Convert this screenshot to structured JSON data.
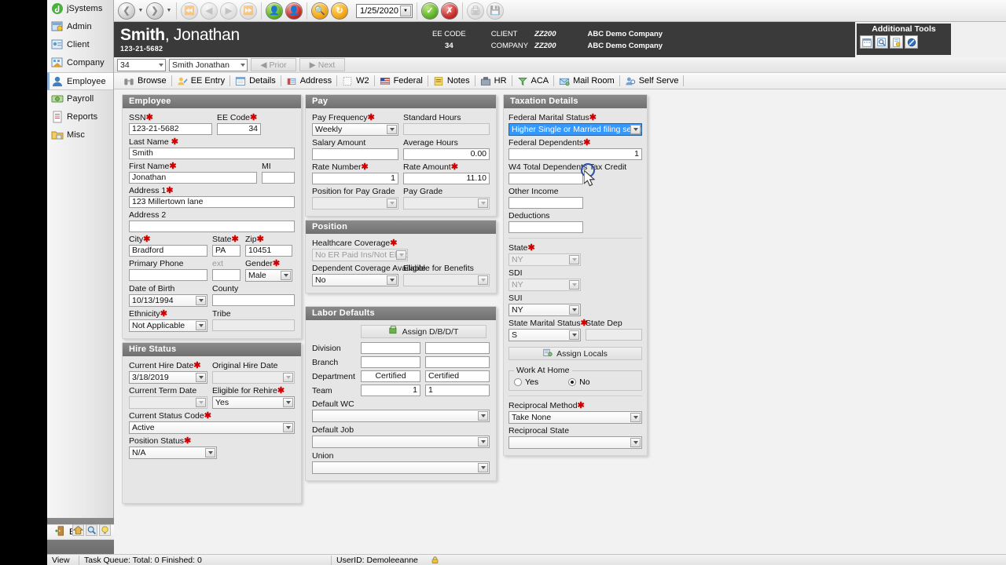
{
  "sidebar": {
    "items": [
      {
        "label": "jSystems",
        "icon": "app-logo-icon",
        "selected": false
      },
      {
        "label": "Admin",
        "icon": "admin-icon",
        "selected": false
      },
      {
        "label": "Client",
        "icon": "client-icon",
        "selected": false
      },
      {
        "label": "Company",
        "icon": "company-icon",
        "selected": false
      },
      {
        "label": "Employee",
        "icon": "employee-icon",
        "selected": true
      },
      {
        "label": "Payroll",
        "icon": "payroll-icon",
        "selected": false
      },
      {
        "label": "Reports",
        "icon": "reports-icon",
        "selected": false
      },
      {
        "label": "Misc",
        "icon": "misc-icon",
        "selected": false
      }
    ],
    "exit_label": "Exit",
    "quick_icons": [
      "home-icon",
      "search-icon",
      "help-icon"
    ]
  },
  "toolbar": {
    "date_value": "1/25/2020",
    "buttons": [
      {
        "name": "back-button",
        "icon": "arrow-back-icon"
      },
      {
        "name": "forward-button",
        "icon": "arrow-forward-icon"
      },
      {
        "name": "first-record-button",
        "icon": "first-record-icon"
      },
      {
        "name": "prev-record-button",
        "icon": "prev-record-icon"
      },
      {
        "name": "next-record-button",
        "icon": "next-record-icon"
      },
      {
        "name": "last-record-button",
        "icon": "last-record-icon"
      },
      {
        "name": "add-employee-button",
        "icon": "add-person-icon"
      },
      {
        "name": "delete-employee-button",
        "icon": "delete-person-icon"
      },
      {
        "name": "find-button",
        "icon": "magnifier-icon"
      },
      {
        "name": "refresh-button",
        "icon": "refresh-icon"
      },
      {
        "name": "save-button",
        "icon": "check-icon"
      },
      {
        "name": "cancel-button",
        "icon": "x-icon"
      },
      {
        "name": "print-button",
        "icon": "print-icon"
      },
      {
        "name": "export-button",
        "icon": "export-icon"
      }
    ]
  },
  "header": {
    "last_name": "Smith",
    "first_name": ", Jonathan",
    "ssn": "123-21-5682",
    "ee_code_label": "EE CODE",
    "ee_code_value": "34",
    "client_label": "CLIENT",
    "client_code": "ZZ200",
    "client_name": "ABC Demo Company",
    "company_label": "COMPANY",
    "company_code": "ZZ200",
    "company_name": "ABC Demo Company"
  },
  "additional_tools": {
    "title": "Additional Tools",
    "buttons": [
      "calendar-icon",
      "preview-icon",
      "document-lock-icon",
      "block-icon"
    ]
  },
  "navbar": {
    "ee_code_value": "34",
    "employee_value": "Smith Jonathan",
    "prior_label": "Prior",
    "next_label": "Next"
  },
  "tabs": [
    {
      "label": "Browse",
      "icon": "binoculars-icon",
      "active": false
    },
    {
      "label": "EE Entry",
      "icon": "ee-entry-icon",
      "active": true
    },
    {
      "label": "Details",
      "icon": "details-icon",
      "active": false
    },
    {
      "label": "Address",
      "icon": "address-icon",
      "active": false
    },
    {
      "label": "W2",
      "icon": "w2-icon",
      "active": false
    },
    {
      "label": "Federal",
      "icon": "flag-icon",
      "active": false
    },
    {
      "label": "Notes",
      "icon": "notes-icon",
      "active": false
    },
    {
      "label": "HR",
      "icon": "hr-icon",
      "active": false
    },
    {
      "label": "ACA",
      "icon": "aca-icon",
      "active": false
    },
    {
      "label": "Mail Room",
      "icon": "mail-icon",
      "active": false
    },
    {
      "label": "Self Serve",
      "icon": "self-serve-icon",
      "active": false
    }
  ],
  "employee_panel": {
    "title": "Employee",
    "ssn_label": "SSN",
    "ssn_value": "123-21-5682",
    "ee_code_label": "EE Code",
    "ee_code_value": "34",
    "last_name_label": "Last Name",
    "last_name_value": "Smith",
    "first_name_label": "First Name",
    "first_name_value": "Jonathan",
    "mi_label": "MI",
    "mi_value": "",
    "address1_label": "Address 1",
    "address1_value": "123 Millertown lane",
    "address2_label": "Address 2",
    "address2_value": "",
    "city_label": "City",
    "city_value": "Bradford",
    "state_label": "State",
    "state_value": "PA",
    "zip_label": "Zip",
    "zip_value": "10451",
    "primary_phone_label": "Primary Phone",
    "primary_phone_value": "",
    "ext_label": "ext",
    "ext_value": "",
    "gender_label": "Gender",
    "gender_value": "Male",
    "dob_label": "Date of Birth",
    "dob_value": "10/13/1994",
    "county_label": "County",
    "county_value": "",
    "ethnicity_label": "Ethnicity",
    "ethnicity_value": "Not Applicable",
    "tribe_label": "Tribe",
    "tribe_value": ""
  },
  "hire_status_panel": {
    "title": "Hire Status",
    "current_hire_date_label": "Current Hire Date",
    "current_hire_date_value": "3/18/2019",
    "original_hire_date_label": "Original Hire Date",
    "original_hire_date_value": "",
    "current_term_date_label": "Current Term Date",
    "current_term_date_value": "",
    "eligible_rehire_label": "Eligible for Rehire",
    "eligible_rehire_value": "Yes",
    "current_status_code_label": "Current Status Code",
    "current_status_code_value": "Active",
    "position_status_label": "Position Status",
    "position_status_value": "N/A"
  },
  "pay_panel": {
    "title": "Pay",
    "pay_frequency_label": "Pay Frequency",
    "pay_frequency_value": "Weekly",
    "standard_hours_label": "Standard Hours",
    "standard_hours_value": "",
    "salary_amount_label": "Salary Amount",
    "salary_amount_value": "",
    "average_hours_label": "Average Hours",
    "average_hours_value": "0.00",
    "rate_number_label": "Rate Number",
    "rate_number_value": "1",
    "rate_amount_label": "Rate Amount",
    "rate_amount_value": "11.10",
    "position_for_pay_grade_label": "Position for Pay Grade",
    "position_for_pay_grade_value": "",
    "pay_grade_label": "Pay Grade",
    "pay_grade_value": ""
  },
  "position_panel": {
    "title": "Position",
    "healthcare_coverage_label": "Healthcare Coverage",
    "healthcare_coverage_value": "No ER Paid Ins/Not Eligibl",
    "dependent_coverage_label": "Dependent Coverage Available",
    "dependent_coverage_value": "No",
    "eligible_benefits_label": "Eligible for Benefits",
    "eligible_benefits_value": ""
  },
  "labor_defaults_panel": {
    "title": "Labor Defaults",
    "assign_button_label": "Assign D/B/D/T",
    "rows": [
      {
        "label": "Division",
        "code": "",
        "desc": ""
      },
      {
        "label": "Branch",
        "code": "",
        "desc": ""
      },
      {
        "label": "Department",
        "code": "Certified",
        "desc": "Certified"
      },
      {
        "label": "Team",
        "code": "1",
        "desc": "1"
      }
    ],
    "default_wc_label": "Default WC",
    "default_wc_value": "",
    "default_job_label": "Default Job",
    "default_job_value": "",
    "union_label": "Union",
    "union_value": ""
  },
  "taxation_panel": {
    "title": "Taxation Details",
    "federal_marital_status_label": "Federal Marital Status",
    "federal_marital_status_value": "Higher Single or Married filing separately",
    "federal_dependents_label": "Federal Dependents",
    "federal_dependents_value": "1",
    "w4_total_dependents_label": "W4 Total Dependents Tax Credit",
    "w4_total_dependents_value": "",
    "other_income_label": "Other Income",
    "other_income_value": "",
    "deductions_label": "Deductions",
    "deductions_value": "",
    "state_label": "State",
    "state_value": "NY",
    "sdi_label": "SDI",
    "sdi_value": "NY",
    "sui_label": "SUI",
    "sui_value": "NY",
    "state_marital_status_label": "State Marital Status",
    "state_marital_status_value": "S",
    "state_dep_label": "State Dep",
    "state_dep_value": "",
    "assign_locals_label": "Assign Locals",
    "work_at_home_label": "Work At Home",
    "work_at_home_yes": "Yes",
    "work_at_home_no": "No",
    "work_at_home_selected": "No",
    "reciprocal_method_label": "Reciprocal Method",
    "reciprocal_method_value": "Take None",
    "reciprocal_state_label": "Reciprocal State",
    "reciprocal_state_value": ""
  },
  "statusbar": {
    "view_label": "View",
    "task_queue": "Task Queue: Total: 0  Finished: 0",
    "user_id": "UserID: Demoleeanne",
    "lock_icon": "lock-icon"
  },
  "colors": {
    "header_bg": "#3a3a3a",
    "panel_title_bg": "#707070",
    "required_marker": "#d00000",
    "highlight": "#3399ff"
  }
}
